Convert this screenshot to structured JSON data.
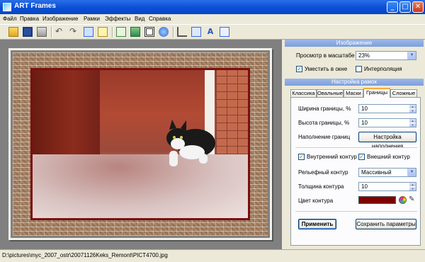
{
  "window": {
    "title": "ART Frames",
    "minimize": "_",
    "maximize": "□",
    "close": "✕"
  },
  "menu": [
    "Файл",
    "Правка",
    "Изображение",
    "Рамки",
    "Эффекты",
    "Вид",
    "Справка"
  ],
  "toolbar": {
    "icons": [
      "open-icon",
      "save-icon",
      "print-icon",
      "undo-icon",
      "redo-icon",
      "copy-icon",
      "paste-icon",
      "export-icon",
      "image-icon",
      "frame-icon",
      "effects-icon",
      "crop-icon",
      "rotate-icon",
      "text-icon",
      "properties-icon"
    ]
  },
  "statusbar": {
    "path": "D:\\pictures\\myc_2007_ostr\\20071126Keks_Remont\\PICT4700.jpg"
  },
  "panel": {
    "image_section": {
      "header": "Изображение",
      "zoom_label": "Просмотр в масштабе",
      "zoom_value": "23%",
      "fit_label": "Уместить в окне",
      "fit_checked": true,
      "interp_label": "Интерполяция",
      "interp_checked": false
    },
    "frame_section": {
      "header": "Настройка рамок",
      "tabs": [
        "Классика",
        "Овальные",
        "Маски",
        "Границы",
        "Сложные"
      ],
      "active_tab": 3,
      "border_width_label": "Ширина границы, %",
      "border_width_value": "10",
      "border_height_label": "Высота границы, %",
      "border_height_value": "10",
      "fill_label": "Наполнение границ",
      "fill_button": "Настройка наполнения",
      "inner_contour_label": "Внутренний контур",
      "inner_contour_checked": true,
      "outer_contour_label": "Внешний контур",
      "outer_contour_checked": true,
      "relief_label": "Рельефный контур",
      "relief_value": "Массивный",
      "thickness_label": "Толщина контура",
      "thickness_value": "10",
      "color_label": "Цвет контура",
      "color_value": "#800000",
      "apply_button": "Применить",
      "save_button": "Сохранить параметры"
    }
  }
}
